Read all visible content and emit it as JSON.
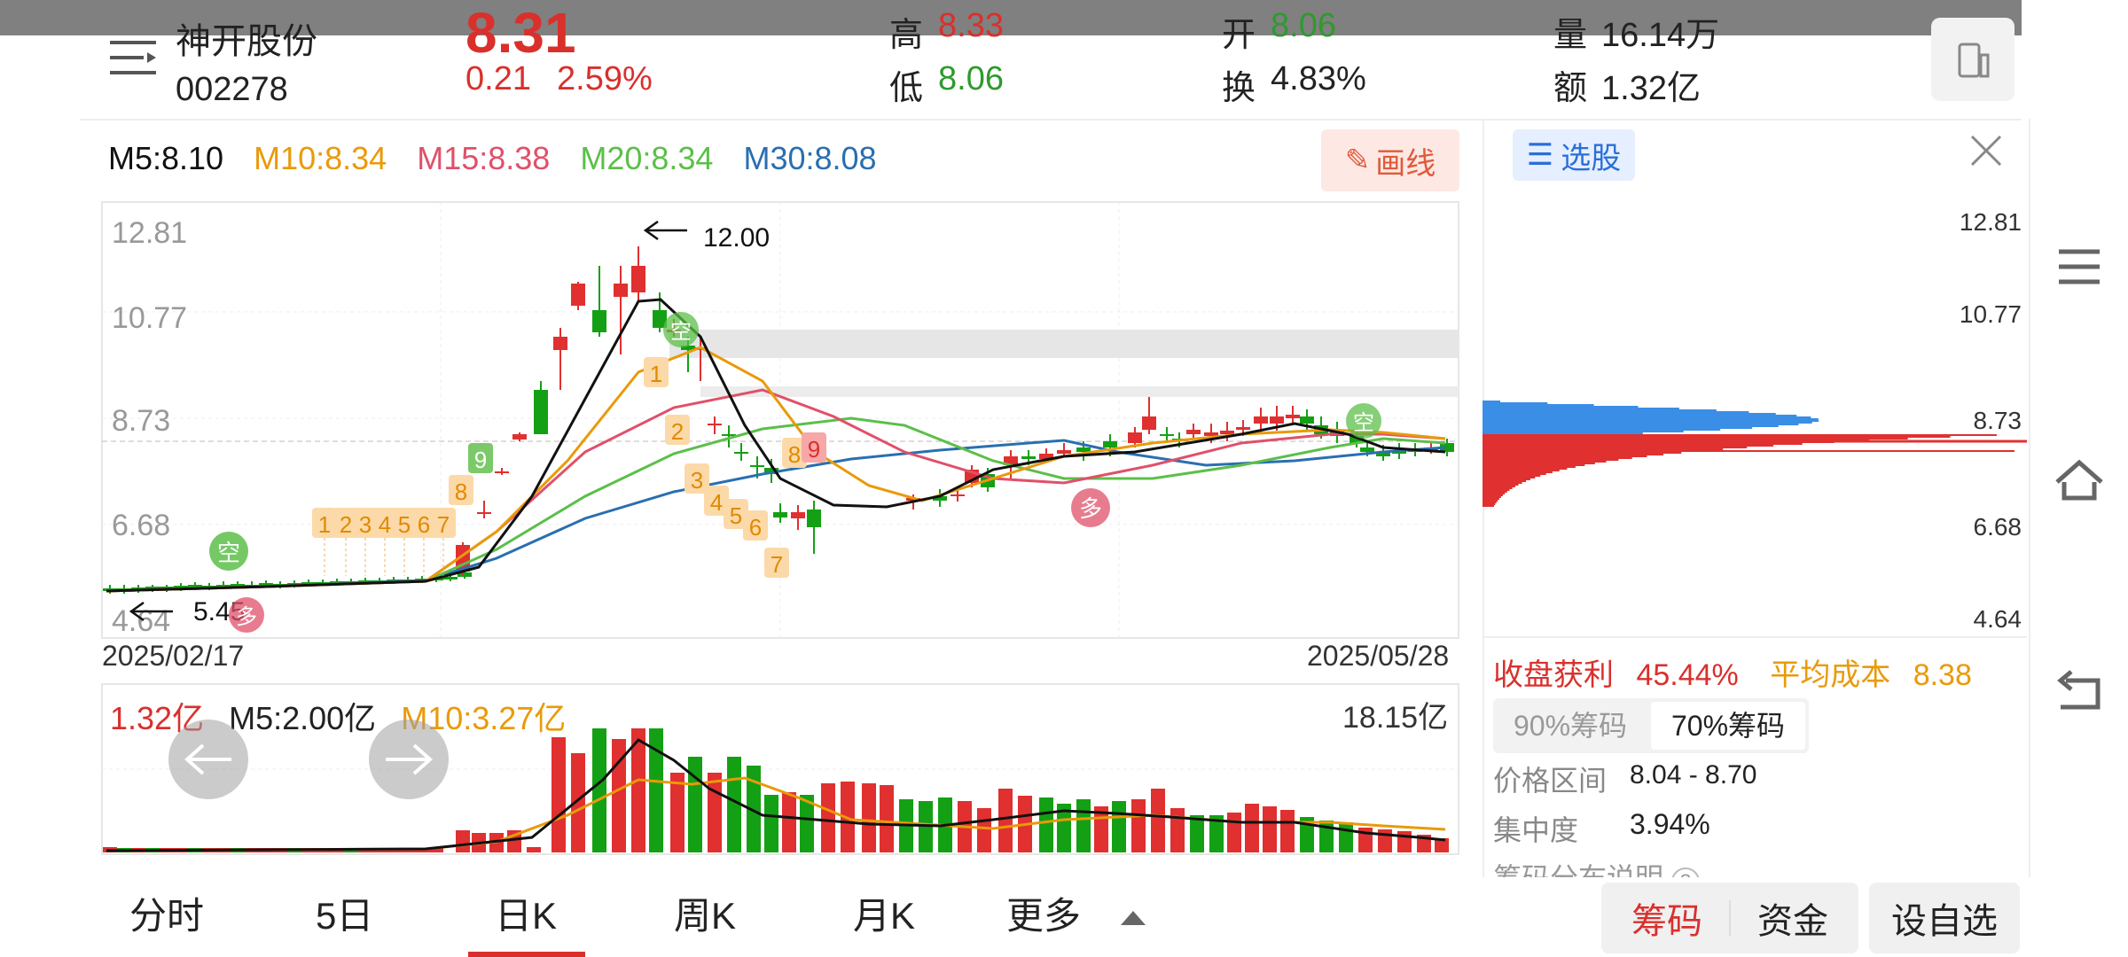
{
  "header": {
    "stock_name": "神开股份",
    "stock_code": "002278",
    "price": "8.31",
    "change": "0.21",
    "change_pct": "2.59%",
    "high_label": "高",
    "high_value": "8.33",
    "low_label": "低",
    "low_value": "8.06",
    "open_label": "开",
    "open_value": "8.06",
    "turnover_label": "换",
    "turnover_value": "4.83%",
    "volume_label": "量",
    "volume_value": "16.14万",
    "amount_label": "额",
    "amount_value": "1.32亿"
  },
  "ma_legend": {
    "m5": "M5:8.10",
    "m10": "M10:8.34",
    "m15": "M15:8.38",
    "m20": "M20:8.34",
    "m30": "M30:8.08"
  },
  "draw_button": "画线",
  "chart_data": {
    "type": "candlestick",
    "y_ticks": [
      "12.81",
      "10.77",
      "8.73",
      "6.68",
      "4.64"
    ],
    "start_date": "2025/02/17",
    "end_date": "2025/05/28",
    "max_label": "12.00",
    "min_label": "5.45",
    "marker_kong": "空",
    "marker_duo": "多",
    "td_seq_up": [
      "1",
      "2",
      "3",
      "4",
      "5",
      "6",
      "7",
      "8",
      "9"
    ],
    "td_seq_down": [
      "1",
      "2",
      "3",
      "4",
      "5",
      "6",
      "7",
      "8",
      "9"
    ]
  },
  "volume_panel": {
    "vol": "1.32亿",
    "m5": "M5:2.00亿",
    "m10": "M10:3.27亿",
    "max": "18.15亿"
  },
  "chip_panel": {
    "select_label": "选股",
    "ticks": [
      "12.81",
      "10.77",
      "8.73",
      "6.68",
      "4.64"
    ],
    "profit_label": "收盘获利",
    "profit_value": "45.44%",
    "avg_cost_label": "平均成本",
    "avg_cost_value": "8.38",
    "tab_90": "90%筹码",
    "tab_70": "70%筹码",
    "range_label": "价格区间",
    "range_value": "8.04 - 8.70",
    "concentration_label": "集中度",
    "concentration_value": "3.94%",
    "explain_label": "筹码分布说明"
  },
  "tabs": [
    "分时",
    "5日",
    "日K",
    "周K",
    "月K",
    "更多"
  ],
  "bottom_buttons": {
    "chips": "筹码",
    "funds": "资金",
    "watch": "设自选"
  }
}
